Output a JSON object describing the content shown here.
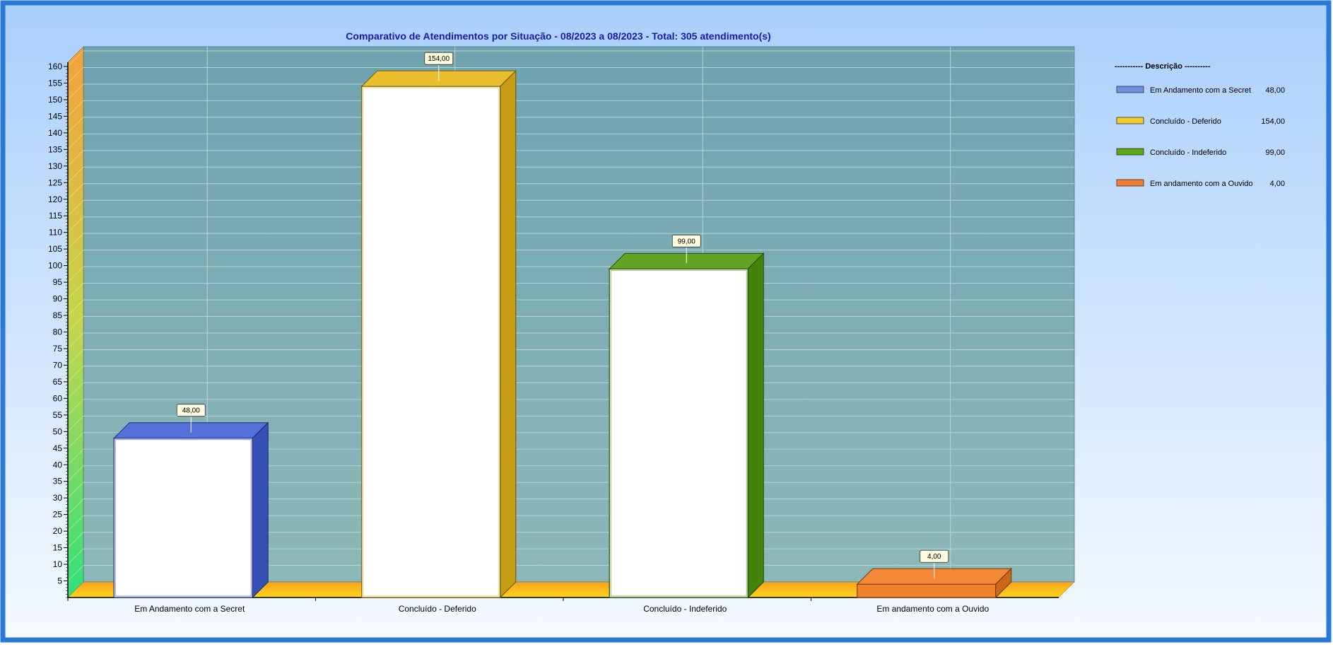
{
  "chart_data": {
    "type": "bar",
    "title": "Comparativo  de  Atendimentos  por  Situação  -  08/2023  a  08/2023  -  Total:  305  atendimento(s)",
    "categories": [
      "Em Andamento com a Secret",
      "Concluído - Deferido",
      "Concluído - Indeferido",
      "Em andamento com a Ouvido"
    ],
    "values": [
      48,
      154,
      99,
      4
    ],
    "data_labels": [
      "48,00",
      "154,00",
      "99,00",
      "4,00"
    ],
    "colors": [
      "#3f5fd6",
      "#e8b817",
      "#4f9a0c",
      "#f07a1e"
    ],
    "ylim": [
      0,
      160
    ],
    "yticks": [
      5,
      10,
      15,
      20,
      25,
      30,
      35,
      40,
      45,
      50,
      55,
      60,
      65,
      70,
      75,
      80,
      85,
      90,
      95,
      100,
      105,
      110,
      115,
      120,
      125,
      130,
      135,
      140,
      145,
      150,
      155,
      160
    ],
    "grid": true,
    "legend": {
      "title": "----------- Descrição ----------",
      "placement": "right",
      "entries": [
        {
          "label": "Em Andamento com a Secret",
          "value": "48,00",
          "color": "#6f8fe8"
        },
        {
          "label": "Concluído - Deferido",
          "value": "154,00",
          "color": "#f5cc2a"
        },
        {
          "label": "Concluído - Indeferido",
          "value": "99,00",
          "color": "#5ea513"
        },
        {
          "label": "Em andamento com a Ouvido",
          "value": "4,00",
          "color": "#f47c2a"
        }
      ]
    }
  }
}
